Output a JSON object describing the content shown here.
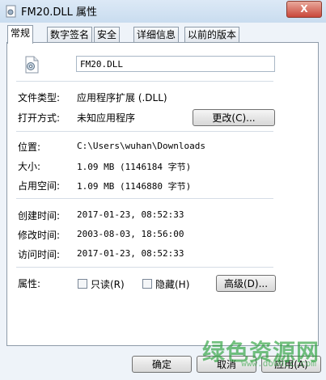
{
  "window": {
    "title": "FM20.DLL 属性",
    "close_glyph": "X"
  },
  "tabs": [
    "常规",
    "数字签名",
    "安全",
    "详细信息",
    "以前的版本"
  ],
  "file": {
    "name": "FM20.DLL"
  },
  "props": {
    "type_label": "文件类型:",
    "type_value": "应用程序扩展 (.DLL)",
    "open_label": "打开方式:",
    "open_value": "未知应用程序",
    "change_button": "更改(C)...",
    "location_label": "位置:",
    "location_value": "C:\\Users\\wuhan\\Downloads",
    "size_label": "大小:",
    "size_value": "1.09 MB (1146184 字节)",
    "disk_label": "占用空间:",
    "disk_value": "1.09 MB (1146880 字节)",
    "created_label": "创建时间:",
    "created_value": "2017-01-23, 08:52:33",
    "modified_label": "修改时间:",
    "modified_value": "2003-08-03, 18:56:00",
    "accessed_label": "访问时间:",
    "accessed_value": "2017-01-23, 08:52:33",
    "attr_label": "属性:",
    "readonly_label": "只读(R)",
    "hidden_label": "隐藏(H)",
    "advanced_button": "高级(D)..."
  },
  "footer": {
    "ok": "确定",
    "cancel": "取消",
    "apply": "应用(A)"
  },
  "watermark": {
    "text": "绿色资源网",
    "sub": "www.downcc.com"
  }
}
